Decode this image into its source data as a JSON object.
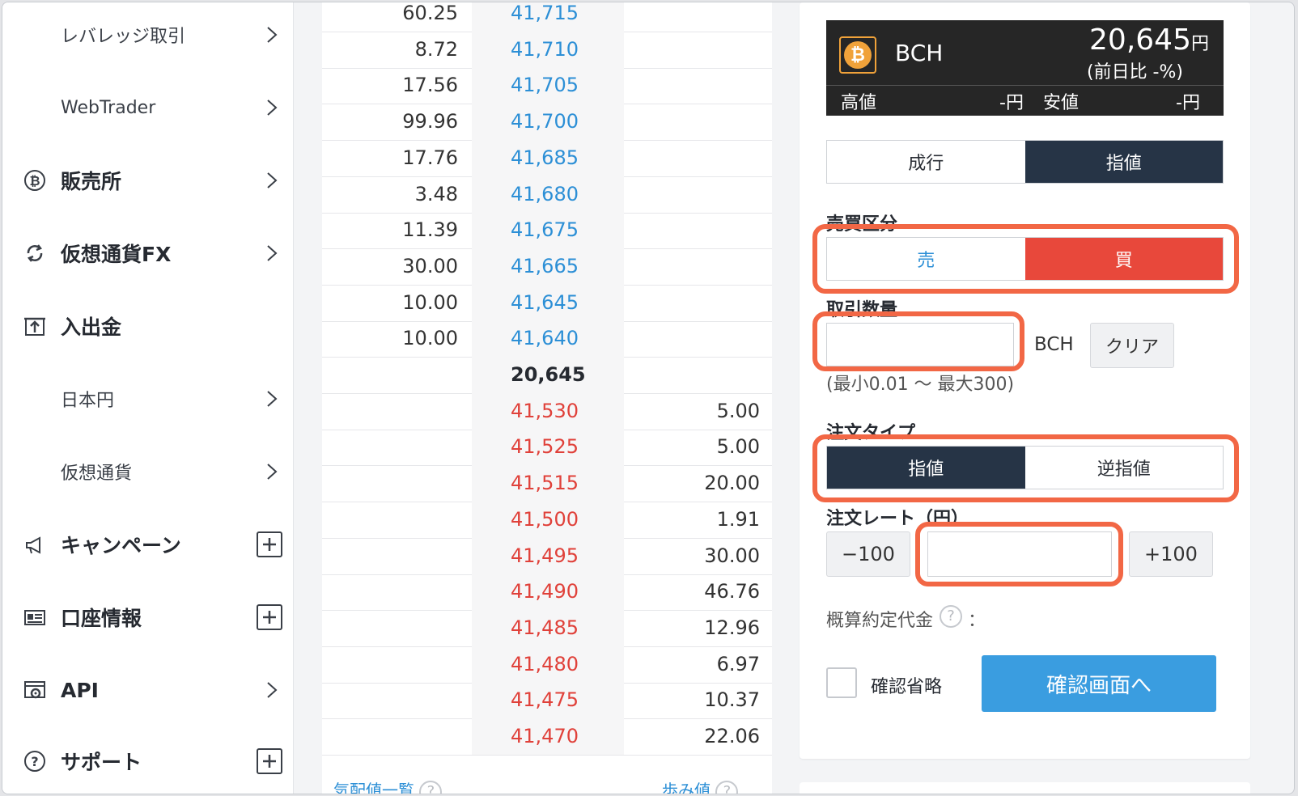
{
  "sidebar": {
    "items": [
      {
        "label": "レバレッジ取引"
      },
      {
        "label": "WebTrader"
      },
      {
        "label": "販売所"
      },
      {
        "label": "仮想通貨FX"
      },
      {
        "label": "入出金"
      },
      {
        "label": "日本円"
      },
      {
        "label": "仮想通貨"
      },
      {
        "label": "キャンペーン"
      },
      {
        "label": "口座情報"
      },
      {
        "label": "API"
      },
      {
        "label": "サポート"
      }
    ]
  },
  "order_book": {
    "asks": [
      {
        "qty": "60.25",
        "price": "41,715"
      },
      {
        "qty": "8.72",
        "price": "41,710"
      },
      {
        "qty": "17.56",
        "price": "41,705"
      },
      {
        "qty": "99.96",
        "price": "41,700"
      },
      {
        "qty": "17.76",
        "price": "41,685"
      },
      {
        "qty": "3.48",
        "price": "41,680"
      },
      {
        "qty": "11.39",
        "price": "41,675"
      },
      {
        "qty": "30.00",
        "price": "41,665"
      },
      {
        "qty": "10.00",
        "price": "41,645"
      },
      {
        "qty": "10.00",
        "price": "41,640"
      }
    ],
    "mid_price": "20,645",
    "bids": [
      {
        "price": "41,530",
        "qty": "5.00"
      },
      {
        "price": "41,525",
        "qty": "5.00"
      },
      {
        "price": "41,515",
        "qty": "20.00"
      },
      {
        "price": "41,500",
        "qty": "1.91"
      },
      {
        "price": "41,495",
        "qty": "30.00"
      },
      {
        "price": "41,490",
        "qty": "46.76"
      },
      {
        "price": "41,485",
        "qty": "12.96"
      },
      {
        "price": "41,480",
        "qty": "6.97"
      },
      {
        "price": "41,475",
        "qty": "10.37"
      },
      {
        "price": "41,470",
        "qty": "22.06"
      }
    ],
    "footer_left": "気配値一覧",
    "footer_right": "歩み値"
  },
  "ticker": {
    "symbol": "BCH",
    "coin_glyph": "₿",
    "price": "20,645",
    "price_unit": "円",
    "change": "(前日比 -%)",
    "high_label": "高値",
    "high_value": "-円",
    "low_label": "安値",
    "low_value": "-円"
  },
  "order_form": {
    "order_method_tabs": [
      "成行",
      "指値"
    ],
    "side_label": "売買区分",
    "side_tabs": [
      "売",
      "買"
    ],
    "qty_label": "取引数量",
    "qty_unit": "BCH",
    "clear_label": "クリア",
    "qty_range": "(最小0.01 〜 最大300)",
    "type_label": "注文タイプ",
    "type_tabs": [
      "指値",
      "逆指値"
    ],
    "rate_label": "注文レート（円）",
    "minus_label": "−100",
    "plus_label": "+100",
    "estimate_label": "概算約定代金",
    "estimate_colon": "：",
    "skip_confirm_label": "確認省略",
    "confirm_button": "確認画面へ"
  },
  "colors": {
    "ask_blue": "#2c8fd6",
    "bid_red": "#e0413a",
    "active_dark": "#263446",
    "buy_red": "#e8483b",
    "confirm_blue": "#3a9de0",
    "highlight_orange": "#f26745"
  }
}
